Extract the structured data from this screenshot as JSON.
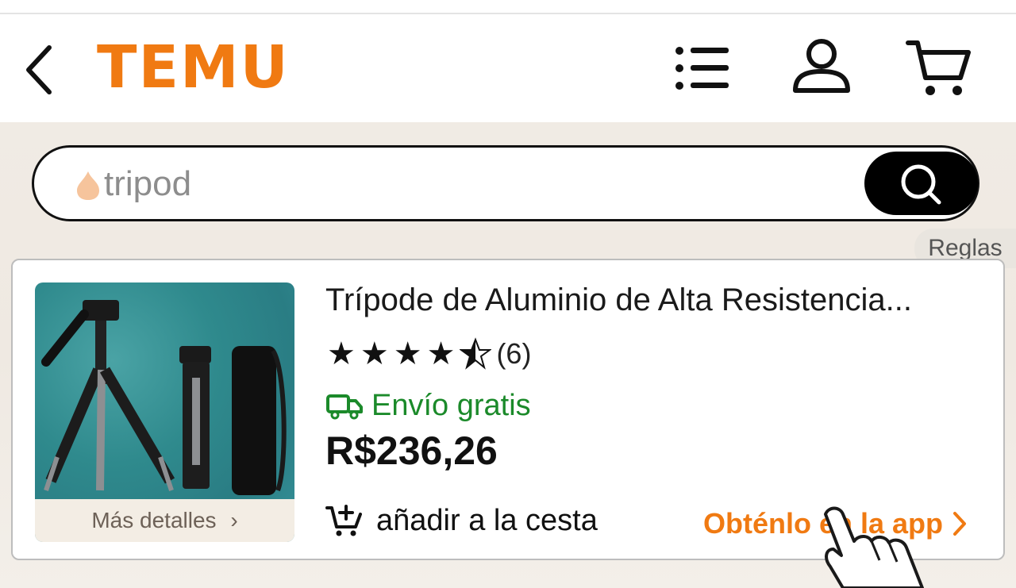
{
  "header": {
    "logo_text": "TEMU",
    "back_icon": "chevron-left-icon",
    "menu_icon": "list-icon",
    "account_icon": "user-icon",
    "cart_icon": "cart-icon"
  },
  "search": {
    "value": "tripod",
    "hint_icon": "flame-icon",
    "button_icon": "search-icon"
  },
  "rules_tab": "Reglas",
  "product": {
    "title": "Trípode de Aluminio de Alta Resistencia...",
    "rating": 4.5,
    "rating_max": 5,
    "review_count": "(6)",
    "shipping": "Envío gratis",
    "price": "R$236,26",
    "more_details": "Más detalles",
    "add_to_cart": "añadir a la cesta",
    "get_in_app": "Obténlo en la app"
  },
  "colors": {
    "brand_orange": "#f07a12",
    "shipping_green": "#1b8a2a"
  }
}
